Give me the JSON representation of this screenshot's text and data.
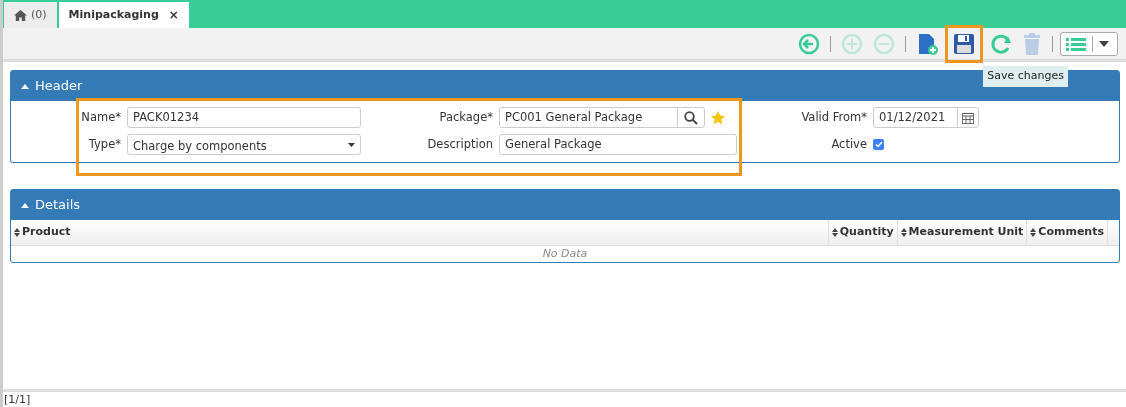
{
  "tabs": [
    {
      "kind": "home",
      "label": "(0)",
      "selected": false
    },
    {
      "kind": "page",
      "label": "Minipackaging",
      "close": "×",
      "selected": true
    }
  ],
  "toolbar": [
    {
      "kind": "back",
      "disabled": false,
      "highlighted": false
    },
    {
      "kind": "add",
      "disabled": true,
      "highlighted": false
    },
    {
      "kind": "remove",
      "disabled": true,
      "highlighted": false
    },
    {
      "kind": "new",
      "disabled": false,
      "highlighted": false
    },
    {
      "kind": "save",
      "disabled": false,
      "highlighted": true
    },
    {
      "kind": "refresh",
      "disabled": false,
      "highlighted": false
    },
    {
      "kind": "delete",
      "disabled": true,
      "highlighted": false
    },
    {
      "kind": "list",
      "disabled": false,
      "highlighted": false
    }
  ],
  "tooltip": "Save changes",
  "header": {
    "title": "Header",
    "expanded": true,
    "highlighted": true,
    "fields": [
      {
        "label": "Name*",
        "kind": "text",
        "value": "PACK01234"
      },
      {
        "label": "Package*",
        "kind": "lookup",
        "value": "PC001 General Package",
        "favorite": true
      },
      {
        "label": "Valid From*",
        "kind": "date",
        "value": "01/12/2021"
      },
      {
        "label": "Type*",
        "kind": "select",
        "value": "Charge by components"
      },
      {
        "label": "Description",
        "kind": "text",
        "value": "General Package"
      },
      {
        "label": "Active",
        "kind": "checkbox",
        "checked": true
      }
    ]
  },
  "details": {
    "title": "Details",
    "expanded": true,
    "columns": [
      "Product",
      "Quantity",
      "Measurement Unit",
      "Comments"
    ],
    "empty_text": "No Data"
  },
  "status_bar": "[1/1]"
}
